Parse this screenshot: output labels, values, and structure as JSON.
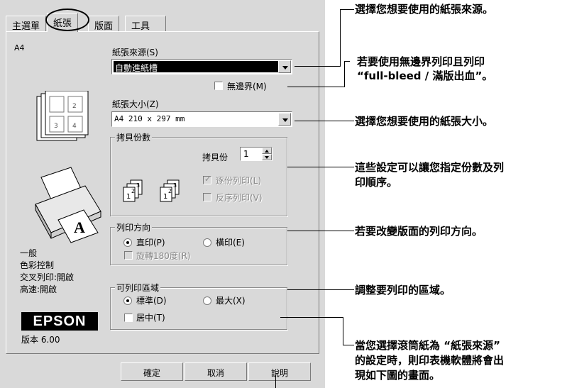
{
  "tabs": [
    "主選單",
    "紙張",
    "版面",
    "工具"
  ],
  "preview": {
    "paper_name": "A4",
    "status_lines": [
      "一般",
      "色彩控制",
      "交叉列印:開啟",
      "高速:開啟"
    ],
    "brand": "EPSON",
    "version": "版本 6.00"
  },
  "paper_source": {
    "label": "紙張來源(S)",
    "value": "自動進紙槽"
  },
  "borderless": {
    "label": "無邊界(M)",
    "checked": false
  },
  "paper_size": {
    "label": "紙張大小(Z)",
    "value": "A4 210 x 297 mm"
  },
  "copies": {
    "group_title": "拷貝份數",
    "count_label": "拷貝份",
    "count_value": "1",
    "collate_label": "逐份列印(L)",
    "collate_checked": true,
    "reverse_label": "反序列印(V)",
    "reverse_checked": false
  },
  "orientation": {
    "group_title": "列印方向",
    "portrait_label": "直印(P)",
    "landscape_label": "橫印(E)",
    "selected": "portrait",
    "rotate_label": "旋轉180度(R)"
  },
  "printable_area": {
    "group_title": "可列印區域",
    "standard_label": "標準(D)",
    "maximum_label": "最大(X)",
    "selected": "standard",
    "center_label": "居中(T)"
  },
  "buttons": {
    "ok": "確定",
    "cancel": "取消",
    "help": "說明"
  },
  "callouts": {
    "source": "選擇您想要使用的紙張來源。",
    "borderless_1": "若要使用無邊界列印且列印",
    "borderless_2": "“full-bleed / 滿版出血”。",
    "size": "選擇您想要使用的紙張大小。",
    "copies_1": "這些設定可以讓您指定份數及列",
    "copies_2": "印順序。",
    "orientation": "若要改變版面的列印方向。",
    "area": "調整要列印的區域。",
    "roll_1": "當您選擇滾筒紙為 “紙張來源”",
    "roll_2": "的設定時，則印表機軟體將會出",
    "roll_3": "現如下圖的畫面。"
  }
}
